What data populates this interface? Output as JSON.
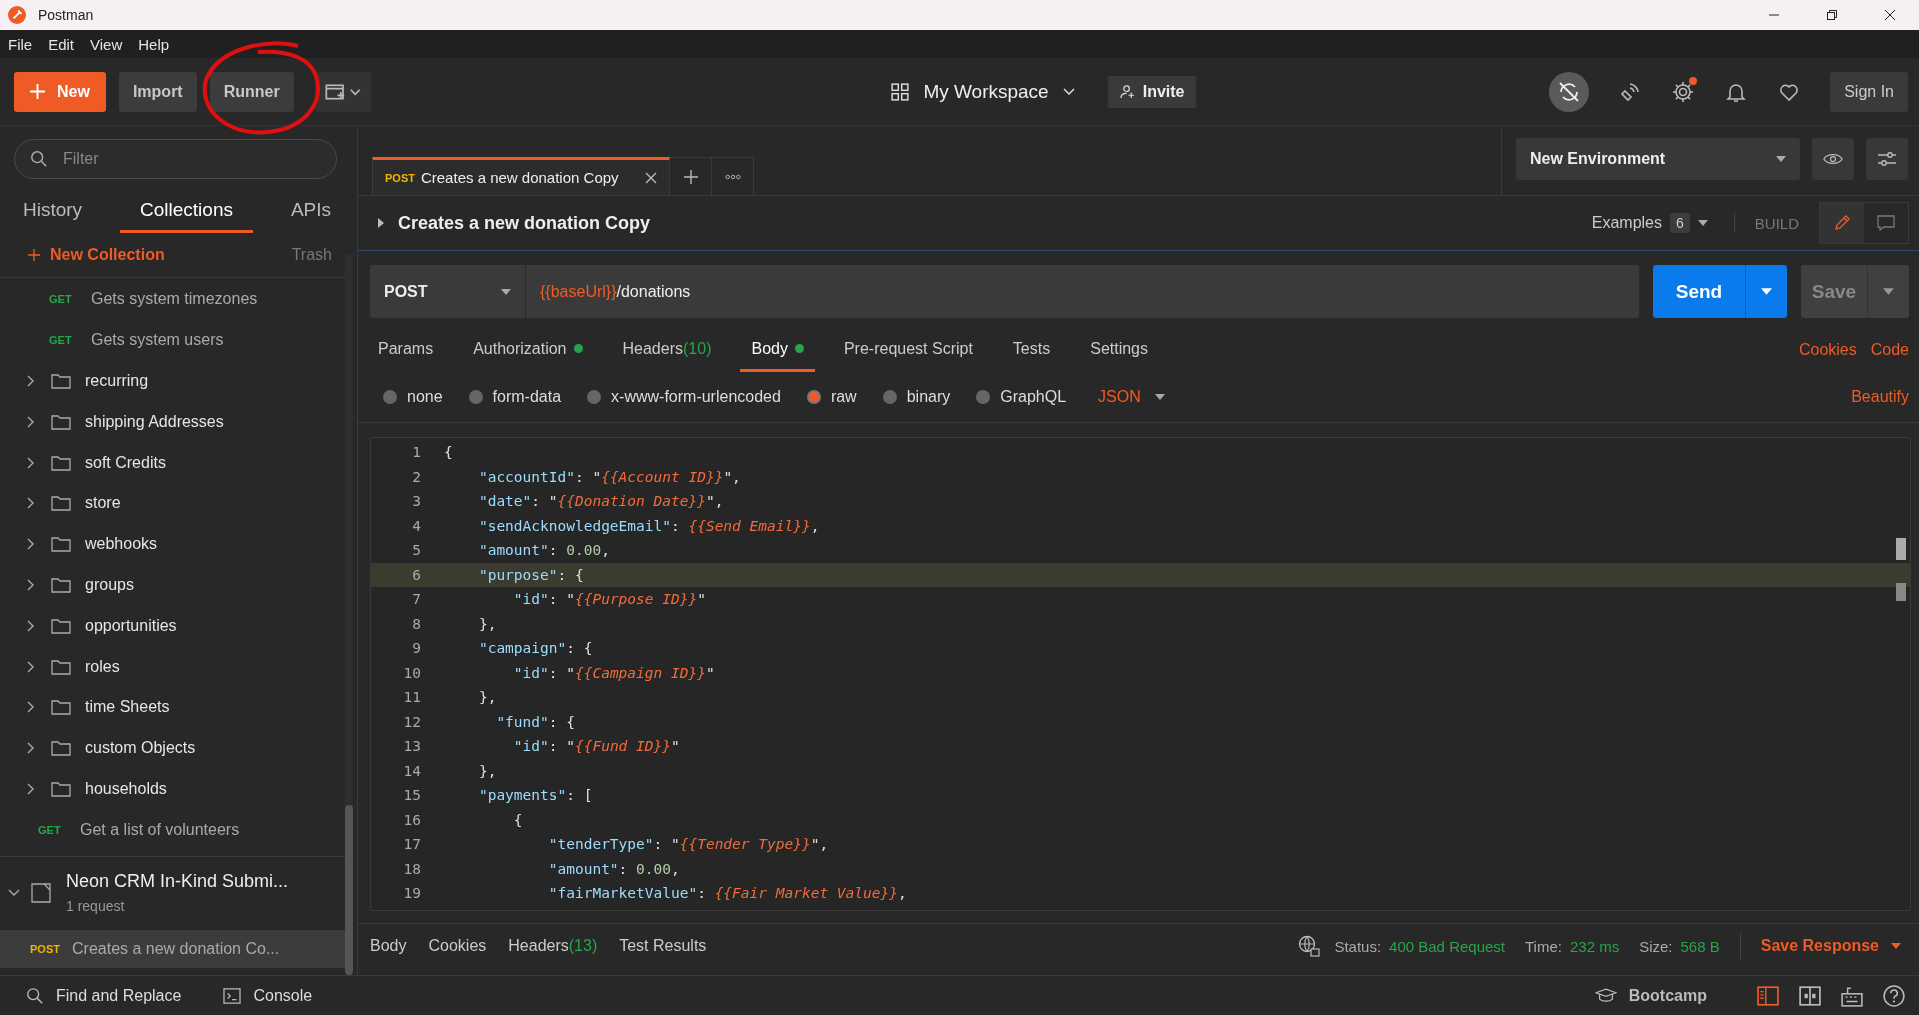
{
  "window": {
    "title": "Postman"
  },
  "menu": [
    "File",
    "Edit",
    "View",
    "Help"
  ],
  "toolbar": {
    "new_button": "New",
    "import_button": "Import",
    "runner_button": "Runner",
    "workspace": "My Workspace",
    "invite_button": "Invite",
    "sign_in_button": "Sign In",
    "settings_notification": true
  },
  "sidebar": {
    "filter_placeholder": "Filter",
    "tabs": [
      {
        "label": "History",
        "selected": false
      },
      {
        "label": "Collections",
        "selected": true
      },
      {
        "label": "APIs",
        "selected": false
      }
    ],
    "new_collection": "New Collection",
    "trash": "Trash",
    "items": [
      {
        "kind": "group",
        "children": [
          {
            "kind": "request",
            "method": "GET",
            "name": "Gets system timezones"
          },
          {
            "kind": "request",
            "method": "GET",
            "name": "Gets system users"
          }
        ]
      },
      {
        "kind": "folder",
        "name": "recurring",
        "expanded": false
      },
      {
        "kind": "folder",
        "name": "shipping Addresses",
        "expanded": false
      },
      {
        "kind": "folder",
        "name": "soft Credits",
        "expanded": false
      },
      {
        "kind": "folder",
        "name": "store",
        "expanded": false
      },
      {
        "kind": "folder",
        "name": "webhooks",
        "expanded": false
      },
      {
        "kind": "folder",
        "name": "groups",
        "expanded": false
      },
      {
        "kind": "folder",
        "name": "opportunities",
        "expanded": false
      },
      {
        "kind": "folder",
        "name": "roles",
        "expanded": false
      },
      {
        "kind": "folder",
        "name": "time Sheets",
        "expanded": false
      },
      {
        "kind": "folder",
        "name": "custom Objects",
        "expanded": false
      },
      {
        "kind": "folder",
        "name": "households",
        "expanded": false
      },
      {
        "kind": "request",
        "method": "GET",
        "name": "Get a list of volunteers"
      }
    ],
    "collection": {
      "name": "Neon CRM In-Kind Submi...",
      "count": "1 request",
      "expanded": true,
      "requests": [
        {
          "method": "POST",
          "name": "Creates a new donation Co...",
          "selected": true
        }
      ]
    }
  },
  "open_tabs": [
    {
      "method": "POST",
      "title": "Creates a new donation Copy",
      "selected": true
    }
  ],
  "environment": "New Environment",
  "request": {
    "name": "Creates a new donation Copy",
    "examples_label": "Examples",
    "examples_count": "6",
    "build_label": "BUILD",
    "method": "POST",
    "url_variable": "{{baseUrl}}",
    "url_path": "/donations",
    "send": "Send",
    "save": "Save",
    "tabs": [
      {
        "label": "Params",
        "dot": false,
        "selected": false
      },
      {
        "label": "Authorization",
        "dot": true,
        "selected": false
      },
      {
        "label": "Headers",
        "count": "(10)",
        "dot": false,
        "selected": false
      },
      {
        "label": "Body",
        "dot": true,
        "selected": true
      },
      {
        "label": "Pre-request Script",
        "dot": false,
        "selected": false
      },
      {
        "label": "Tests",
        "dot": false,
        "selected": false
      },
      {
        "label": "Settings",
        "dot": false,
        "selected": false
      }
    ],
    "links": [
      "Cookies",
      "Code"
    ],
    "body_types": [
      {
        "label": "none",
        "selected": false
      },
      {
        "label": "form-data",
        "selected": false
      },
      {
        "label": "x-www-form-urlencoded",
        "selected": false
      },
      {
        "label": "raw",
        "selected": true
      },
      {
        "label": "binary",
        "selected": false
      },
      {
        "label": "GraphQL",
        "selected": false
      }
    ],
    "format": "JSON",
    "beautify": "Beautify"
  },
  "code_lines": [
    {
      "number": "1",
      "highlighted": false,
      "tokens": [
        {
          "kind": "punct",
          "text": "{"
        }
      ]
    },
    {
      "number": "2",
      "highlighted": false,
      "tokens": [
        {
          "kind": "key",
          "text": "    \"accountId\""
        },
        {
          "kind": "punct",
          "text": ": \""
        },
        {
          "kind": "var",
          "text": "{{Account ID}}"
        },
        {
          "kind": "punct",
          "text": "\","
        }
      ]
    },
    {
      "number": "3",
      "highlighted": false,
      "tokens": [
        {
          "kind": "key",
          "text": "    \"date\""
        },
        {
          "kind": "punct",
          "text": ": \""
        },
        {
          "kind": "var",
          "text": "{{Donation Date}}"
        },
        {
          "kind": "punct",
          "text": "\","
        }
      ]
    },
    {
      "number": "4",
      "highlighted": false,
      "tokens": [
        {
          "kind": "key",
          "text": "    \"sendAcknowledgeEmail\""
        },
        {
          "kind": "punct",
          "text": ": "
        },
        {
          "kind": "var",
          "text": "{{Send Email}}"
        },
        {
          "kind": "punct",
          "text": ","
        }
      ]
    },
    {
      "number": "5",
      "highlighted": false,
      "tokens": [
        {
          "kind": "key",
          "text": "    \"amount\""
        },
        {
          "kind": "punct",
          "text": ": "
        },
        {
          "kind": "number",
          "text": "0.00"
        },
        {
          "kind": "punct",
          "text": ","
        }
      ]
    },
    {
      "number": "6",
      "highlighted": true,
      "tokens": [
        {
          "kind": "key",
          "text": "    \"purpose\""
        },
        {
          "kind": "punct",
          "text": ": {"
        }
      ]
    },
    {
      "number": "7",
      "highlighted": false,
      "tokens": [
        {
          "kind": "key",
          "text": "        \"id\""
        },
        {
          "kind": "punct",
          "text": ": \""
        },
        {
          "kind": "var",
          "text": "{{Purpose ID}}"
        },
        {
          "kind": "punct",
          "text": "\""
        }
      ]
    },
    {
      "number": "8",
      "highlighted": false,
      "tokens": [
        {
          "kind": "punct",
          "text": "    },"
        }
      ]
    },
    {
      "number": "9",
      "highlighted": false,
      "tokens": [
        {
          "kind": "key",
          "text": "    \"campaign\""
        },
        {
          "kind": "punct",
          "text": ": {"
        }
      ]
    },
    {
      "number": "10",
      "highlighted": false,
      "tokens": [
        {
          "kind": "key",
          "text": "        \"id\""
        },
        {
          "kind": "punct",
          "text": ": \""
        },
        {
          "kind": "var",
          "text": "{{Campaign ID}}"
        },
        {
          "kind": "punct",
          "text": "\""
        }
      ]
    },
    {
      "number": "11",
      "highlighted": false,
      "tokens": [
        {
          "kind": "punct",
          "text": "    },"
        }
      ]
    },
    {
      "number": "12",
      "highlighted": false,
      "tokens": [
        {
          "kind": "key",
          "text": "      \"fund\""
        },
        {
          "kind": "punct",
          "text": ": {"
        }
      ]
    },
    {
      "number": "13",
      "highlighted": false,
      "tokens": [
        {
          "kind": "key",
          "text": "        \"id\""
        },
        {
          "kind": "punct",
          "text": ": \""
        },
        {
          "kind": "var",
          "text": "{{Fund ID}}"
        },
        {
          "kind": "punct",
          "text": "\""
        }
      ]
    },
    {
      "number": "14",
      "highlighted": false,
      "tokens": [
        {
          "kind": "punct",
          "text": "    },"
        }
      ]
    },
    {
      "number": "15",
      "highlighted": false,
      "tokens": [
        {
          "kind": "key",
          "text": "    \"payments\""
        },
        {
          "kind": "punct",
          "text": ": ["
        }
      ]
    },
    {
      "number": "16",
      "highlighted": false,
      "tokens": [
        {
          "kind": "punct",
          "text": "        {"
        }
      ]
    },
    {
      "number": "17",
      "highlighted": false,
      "tokens": [
        {
          "kind": "key",
          "text": "            \"tenderType\""
        },
        {
          "kind": "punct",
          "text": ": \""
        },
        {
          "kind": "var",
          "text": "{{Tender Type}}"
        },
        {
          "kind": "punct",
          "text": "\","
        }
      ]
    },
    {
      "number": "18",
      "highlighted": false,
      "tokens": [
        {
          "kind": "key",
          "text": "            \"amount\""
        },
        {
          "kind": "punct",
          "text": ": "
        },
        {
          "kind": "number",
          "text": "0.00"
        },
        {
          "kind": "punct",
          "text": ","
        }
      ]
    },
    {
      "number": "19",
      "highlighted": false,
      "tokens": [
        {
          "kind": "key",
          "text": "            \"fairMarketValue\""
        },
        {
          "kind": "punct",
          "text": ": "
        },
        {
          "kind": "var",
          "text": "{{Fair Market Value}}"
        },
        {
          "kind": "punct",
          "text": ","
        }
      ]
    }
  ],
  "response": {
    "tabs": [
      {
        "label": "Body"
      },
      {
        "label": "Cookies"
      },
      {
        "label": "Headers",
        "count": "(13)"
      },
      {
        "label": "Test Results"
      }
    ],
    "status_label": "Status:",
    "status": "400 Bad Request",
    "time_label": "Time:",
    "time": "232 ms",
    "size_label": "Size:",
    "size": "568 B",
    "save_response": "Save Response"
  },
  "status_bar": {
    "find_replace": "Find and Replace",
    "console": "Console",
    "bootcamp": "Bootcamp"
  }
}
